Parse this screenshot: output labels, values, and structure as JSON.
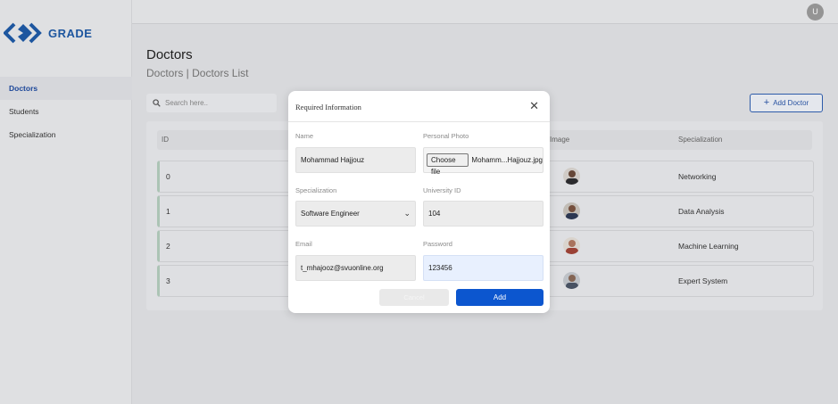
{
  "app": {
    "logo_text": "GRADE",
    "user_initial": "U"
  },
  "sidebar": {
    "items": [
      {
        "label": "Doctors",
        "active": true
      },
      {
        "label": "Students",
        "active": false
      },
      {
        "label": "Specialization",
        "active": false
      }
    ]
  },
  "page": {
    "title": "Doctors",
    "breadcrumb": "Doctors | Doctors List",
    "search_placeholder": "Search here..",
    "add_button_label": "Add Doctor"
  },
  "table": {
    "columns": [
      "ID",
      "Image",
      "Specialization"
    ],
    "rows": [
      {
        "id": "0",
        "specialization": "Networking"
      },
      {
        "id": "1",
        "specialization": "Data Analysis"
      },
      {
        "id": "2",
        "specialization": "Machine Learning"
      },
      {
        "id": "3",
        "specialization": "Expert System"
      }
    ]
  },
  "modal": {
    "title": "Required Information",
    "fields": {
      "name": {
        "label": "Name",
        "value": "Mohammad Hajjouz"
      },
      "photo": {
        "label": "Personal Photo",
        "button": "Choose file",
        "file_name": "Mohamm...Hajjouz.jpg"
      },
      "specialization": {
        "label": "Specialization",
        "value": "Software Engineer"
      },
      "university_id": {
        "label": "University ID",
        "value": "104"
      },
      "email": {
        "label": "Email",
        "value": "t_mhajooz@svuonline.org"
      },
      "password": {
        "label": "Password",
        "value": "123456"
      }
    },
    "cancel_label": "Cancel",
    "add_label": "Add"
  },
  "colors": {
    "primary": "#0c56cf",
    "accent": "#1f5aa6",
    "row_border": "#b4ccbd"
  }
}
